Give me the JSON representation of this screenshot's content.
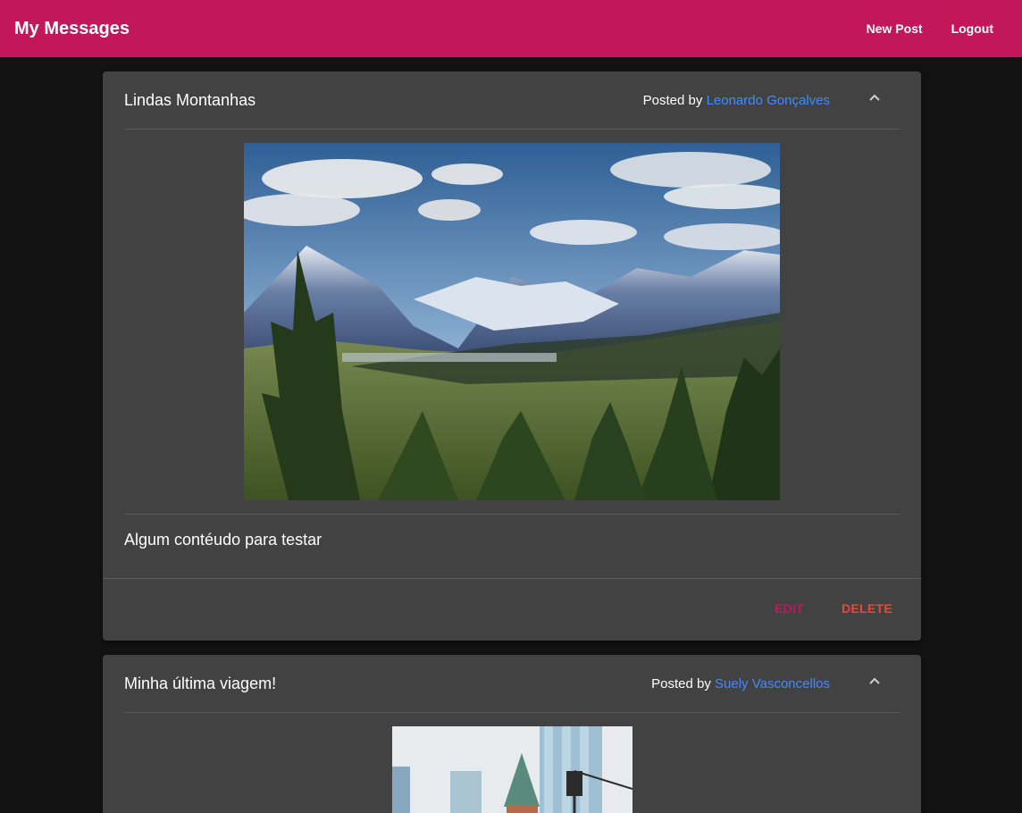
{
  "toolbar": {
    "title": "My Messages",
    "new_post_label": "New Post",
    "logout_label": "Logout"
  },
  "colors": {
    "primary": "#c2185b",
    "warn": "#f44336",
    "link": "#448aff",
    "card": "#424242",
    "background": "#121212"
  },
  "posts": [
    {
      "title": "Lindas Montanhas",
      "posted_by_label": "Posted by",
      "author": "Leonardo Gonçalves",
      "content": "Algum contéudo para testar",
      "edit_label": "EDIT",
      "delete_label": "DELETE",
      "expanded": true
    },
    {
      "title": "Minha última viagem!",
      "posted_by_label": "Posted by",
      "author": "Suely Vasconcellos",
      "expanded": true
    }
  ]
}
